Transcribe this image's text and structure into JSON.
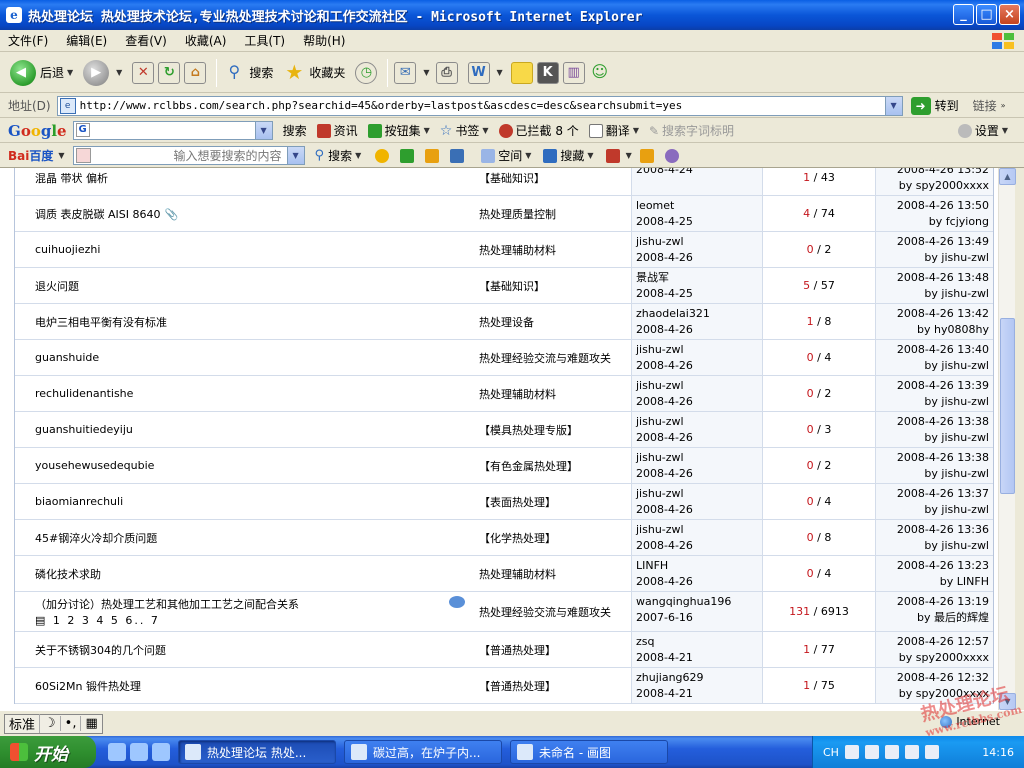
{
  "window": {
    "title": "热处理论坛  热处理技术论坛,专业热处理技术讨论和工作交流社区 - Microsoft Internet Explorer",
    "app_icon": "e",
    "controls": [
      "_",
      "□",
      "×"
    ]
  },
  "menu": [
    "文件(F)",
    "编辑(E)",
    "查看(V)",
    "收藏(A)",
    "工具(T)",
    "帮助(H)"
  ],
  "toolbar": {
    "back": "后退",
    "search": "搜索",
    "favorites": "收藏夹"
  },
  "address": {
    "label": "地址(D)",
    "url": "http://www.rclbbs.com/search.php?searchid=45&orderby=lastpost&ascdesc=desc&searchsubmit=yes",
    "go": "转到",
    "links": "链接"
  },
  "google_bar": {
    "logo": [
      "G",
      "o",
      "o",
      "g",
      "l",
      "e"
    ],
    "search": "搜索",
    "news": "资讯",
    "buttons": "按钮集",
    "bookmarks": "书签",
    "blocked": "已拦截 8 个",
    "translate": "翻译",
    "highlight": "搜索字词标明",
    "settings": "设置"
  },
  "baidu_bar": {
    "logo_bai": "Bai",
    "logo_du": "百度",
    "input_placeholder": "输入想要搜索的内容",
    "search": "搜索",
    "space": "空间",
    "soba": "搜藏"
  },
  "threads": [
    {
      "title": "混晶 带状 偏析",
      "forum": "【基础知识】",
      "author": "",
      "date": "2008-4-24",
      "replies": "1",
      "views": " / 43",
      "last_time": "2008-4-26 13:52",
      "last_by": "by spy2000xxxx"
    },
    {
      "title": "调质 表皮脱碳 AISI 8640",
      "attach": true,
      "forum": "热处理质量控制",
      "author": "leomet",
      "date": "2008-4-25",
      "replies": "4",
      "views": " / 74",
      "last_time": "2008-4-26 13:50",
      "last_by": "by fcjyiong"
    },
    {
      "title": "cuihuojiezhi",
      "forum": "热处理辅助材料",
      "author": "jishu-zwl",
      "date": "2008-4-26",
      "replies": "0",
      "views": " / 2",
      "last_time": "2008-4-26 13:49",
      "last_by": "by jishu-zwl"
    },
    {
      "title": "退火问题",
      "forum": "【基础知识】",
      "author": "景战军",
      "date": "2008-4-25",
      "replies": "5",
      "views": " / 57",
      "last_time": "2008-4-26 13:48",
      "last_by": "by jishu-zwl"
    },
    {
      "title": "电炉三相电平衡有没有标准",
      "forum": "热处理设备",
      "author": "zhaodelai321",
      "date": "2008-4-26",
      "replies": "1",
      "views": " / 8",
      "last_time": "2008-4-26 13:42",
      "last_by": "by hy0808hy"
    },
    {
      "title": "guanshuide",
      "forum": "热处理经验交流与难题攻关",
      "author": "jishu-zwl",
      "date": "2008-4-26",
      "replies": "0",
      "views": " / 4",
      "last_time": "2008-4-26 13:40",
      "last_by": "by jishu-zwl"
    },
    {
      "title": "rechulidenantishe",
      "forum": "热处理辅助材料",
      "author": "jishu-zwl",
      "date": "2008-4-26",
      "replies": "0",
      "views": " / 2",
      "last_time": "2008-4-26 13:39",
      "last_by": "by jishu-zwl"
    },
    {
      "title": "guanshuitiedeyiju",
      "forum": "【模具热处理专版】",
      "author": "jishu-zwl",
      "date": "2008-4-26",
      "replies": "0",
      "views": " / 3",
      "last_time": "2008-4-26 13:38",
      "last_by": "by jishu-zwl"
    },
    {
      "title": "yousehewusedequbie",
      "forum": "【有色金属热处理】",
      "author": "jishu-zwl",
      "date": "2008-4-26",
      "replies": "0",
      "views": " / 2",
      "last_time": "2008-4-26 13:38",
      "last_by": "by jishu-zwl"
    },
    {
      "title": "biaomianrechuli",
      "forum": "【表面热处理】",
      "author": "jishu-zwl",
      "date": "2008-4-26",
      "replies": "0",
      "views": " / 4",
      "last_time": "2008-4-26 13:37",
      "last_by": "by jishu-zwl"
    },
    {
      "title": "45#钢淬火冷却介质问题",
      "forum": "【化学热处理】",
      "author": "jishu-zwl",
      "date": "2008-4-26",
      "replies": "0",
      "views": " / 8",
      "last_time": "2008-4-26 13:36",
      "last_by": "by jishu-zwl"
    },
    {
      "title": "磷化技术求助",
      "forum": "热处理辅助材料",
      "author": "LINFH",
      "date": "2008-4-26",
      "replies": "0",
      "views": " / 4",
      "last_time": "2008-4-26 13:23",
      "last_by": "by LINFH"
    },
    {
      "title": "（加分讨论）热处理工艺和其他加工工艺之间配合关系",
      "pages": "1 2 3 4 5 6.. 7",
      "forum": "热处理经验交流与难题攻关",
      "author": "wangqinghua196",
      "date": "2007-6-16",
      "replies": "131",
      "views": " / 6913",
      "last_time": "2008-4-26 13:19",
      "last_by": "by 最后的辉煌"
    },
    {
      "title": "关于不锈钢304的几个问题",
      "forum": "【普通热处理】",
      "author": "zsq",
      "date": "2008-4-21",
      "replies": "1",
      "views": " / 77",
      "last_time": "2008-4-26 12:57",
      "last_by": "by spy2000xxxx"
    },
    {
      "title": "60Si2Mn 锻件热处理",
      "forum": "【普通热处理】",
      "author": "zhujiang629",
      "date": "2008-4-21",
      "replies": "1",
      "views": " / 75",
      "last_time": "2008-4-26 12:32",
      "last_by": "by spy2000xxxx"
    }
  ],
  "status": {
    "ime": [
      "标准",
      "☽",
      "•,",
      "▦"
    ],
    "zone": "Internet",
    "watermark": "热处理论坛",
    "watermark_url": "www.rclbbs.com"
  },
  "taskbar": {
    "start": "开始",
    "tasks": [
      "热处理论坛  热处...",
      "碳过高，在炉子内...",
      "未命名 - 画图"
    ],
    "lang": "CH",
    "clock": "14:16"
  }
}
